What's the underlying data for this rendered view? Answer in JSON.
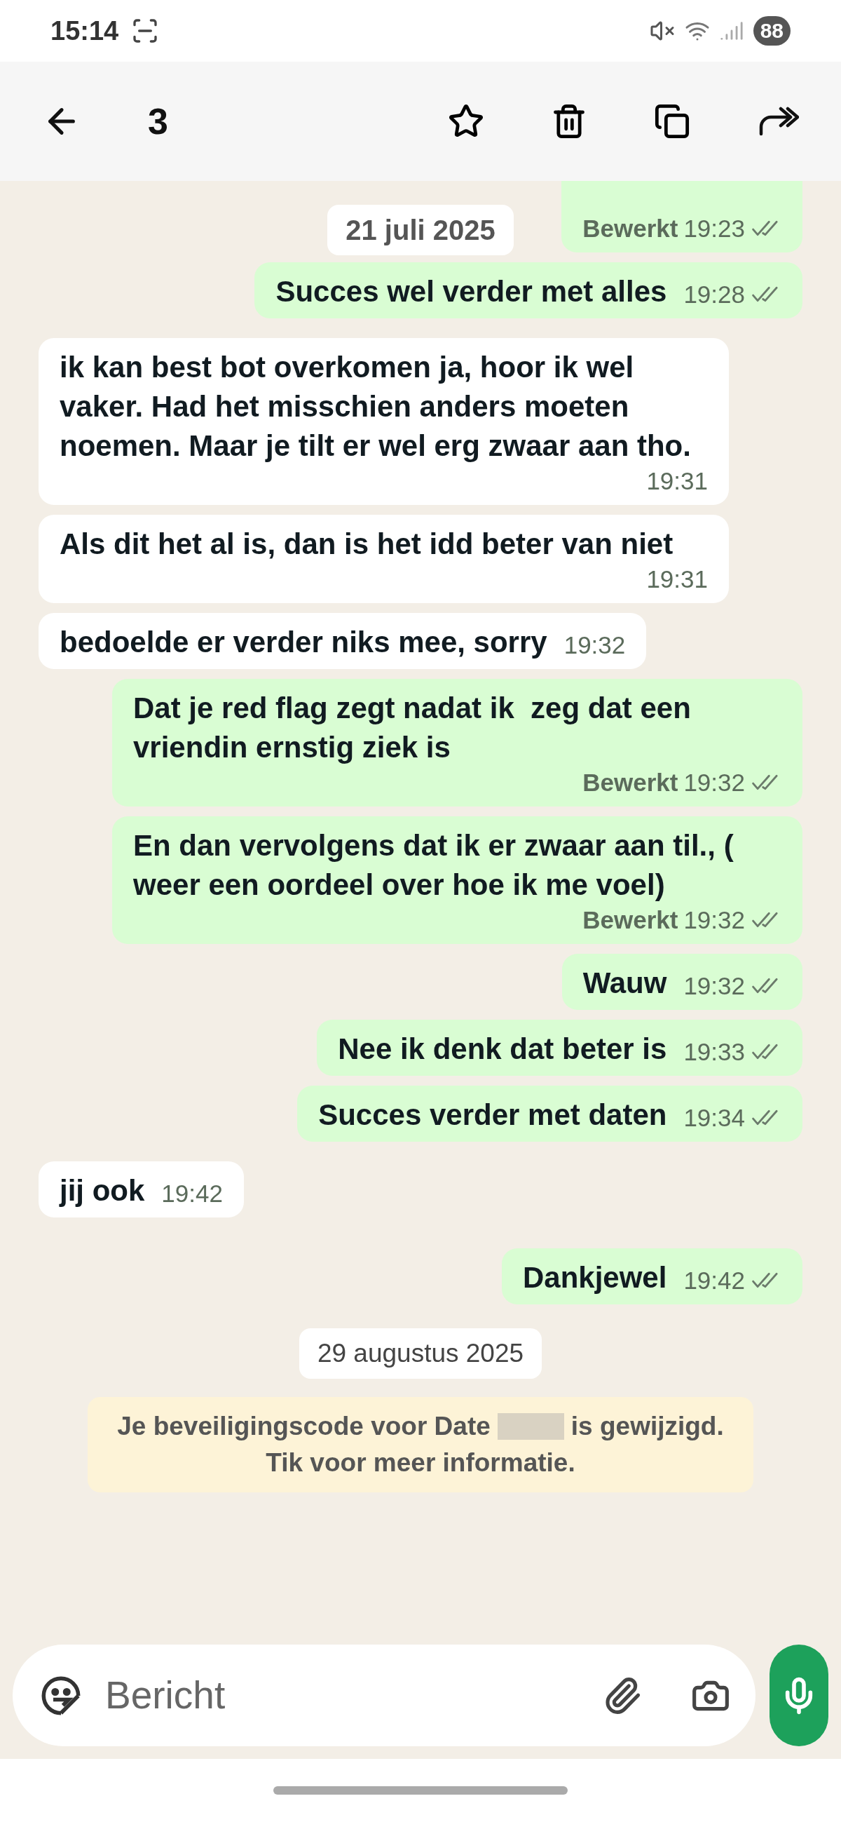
{
  "status_bar": {
    "time": "15:14",
    "battery": "88"
  },
  "header": {
    "selected_count": "3"
  },
  "sticky_date": "21 juli 2025",
  "messages": [
    {
      "kind": "message",
      "outgoing": true,
      "edited": "Bewerkt",
      "time": "19:23",
      "delivered": true
    },
    {
      "kind": "message",
      "outgoing": true,
      "text": "Succes wel verder met alles",
      "time": "19:28",
      "delivered": true
    },
    {
      "kind": "message",
      "outgoing": false,
      "text": "ik kan best bot overkomen ja, hoor ik wel vaker. Had het misschien anders moeten noemen. Maar je tilt er wel erg zwaar aan tho.",
      "time": "19:31"
    },
    {
      "kind": "message",
      "outgoing": false,
      "text": "Als dit het al is, dan is het idd beter van niet",
      "time": "19:31"
    },
    {
      "kind": "message",
      "outgoing": false,
      "text": "bedoelde er verder niks mee, sorry",
      "time": "19:32"
    },
    {
      "kind": "message",
      "outgoing": true,
      "text": "Dat je red flag zegt nadat ik  zeg dat een vriendin ernstig ziek is",
      "edited": "Bewerkt",
      "time": "19:32",
      "delivered": true
    },
    {
      "kind": "message",
      "outgoing": true,
      "text": "En dan vervolgens dat ik er zwaar aan til., ( weer een oordeel over hoe ik me voel)",
      "edited": "Bewerkt",
      "time": "19:32",
      "delivered": true
    },
    {
      "kind": "message",
      "outgoing": true,
      "text": "Wauw",
      "time": "19:32",
      "delivered": true
    },
    {
      "kind": "message",
      "outgoing": true,
      "text": "Nee ik denk dat beter is",
      "time": "19:33",
      "delivered": true
    },
    {
      "kind": "message",
      "outgoing": true,
      "text": "Succes verder met daten",
      "time": "19:34",
      "delivered": true
    },
    {
      "kind": "message",
      "outgoing": false,
      "text": "jij ook",
      "time": "19:42"
    },
    {
      "kind": "message",
      "outgoing": true,
      "text": "Dankjewel",
      "time": "19:42",
      "delivered": true
    },
    {
      "kind": "date",
      "text": "29 augustus 2025"
    },
    {
      "kind": "system",
      "text_before": "Je beveiligingscode voor Date",
      "text_after": "is gewijzigd.",
      "text_line2": "Tik voor meer informatie."
    }
  ],
  "composer": {
    "placeholder": "Bericht"
  }
}
